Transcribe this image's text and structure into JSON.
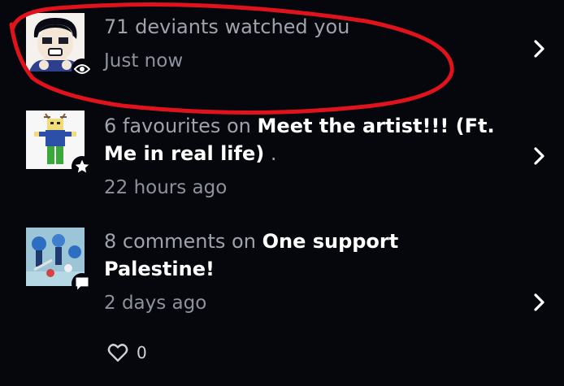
{
  "notifications": [
    {
      "count_text": "71 deviants watched you",
      "title": "",
      "suffix": "",
      "time": "Just now",
      "badge_icon": "eye-icon"
    },
    {
      "count_text": "6 favourites on ",
      "title": "Meet the artist!!! (Ft. Me in real life)",
      "suffix": " .",
      "time": "22 hours ago",
      "badge_icon": "star-icon"
    },
    {
      "count_text": "8 comments on ",
      "title": "One support Palestine!",
      "suffix": "",
      "time": "2 days ago",
      "badge_icon": "comment-icon"
    }
  ],
  "likes": {
    "count": "0",
    "icon": "heart-outline-icon"
  },
  "colors": {
    "background": "#06070c",
    "scribble": "#e0131c",
    "muted_text": "#9fa3ad"
  }
}
